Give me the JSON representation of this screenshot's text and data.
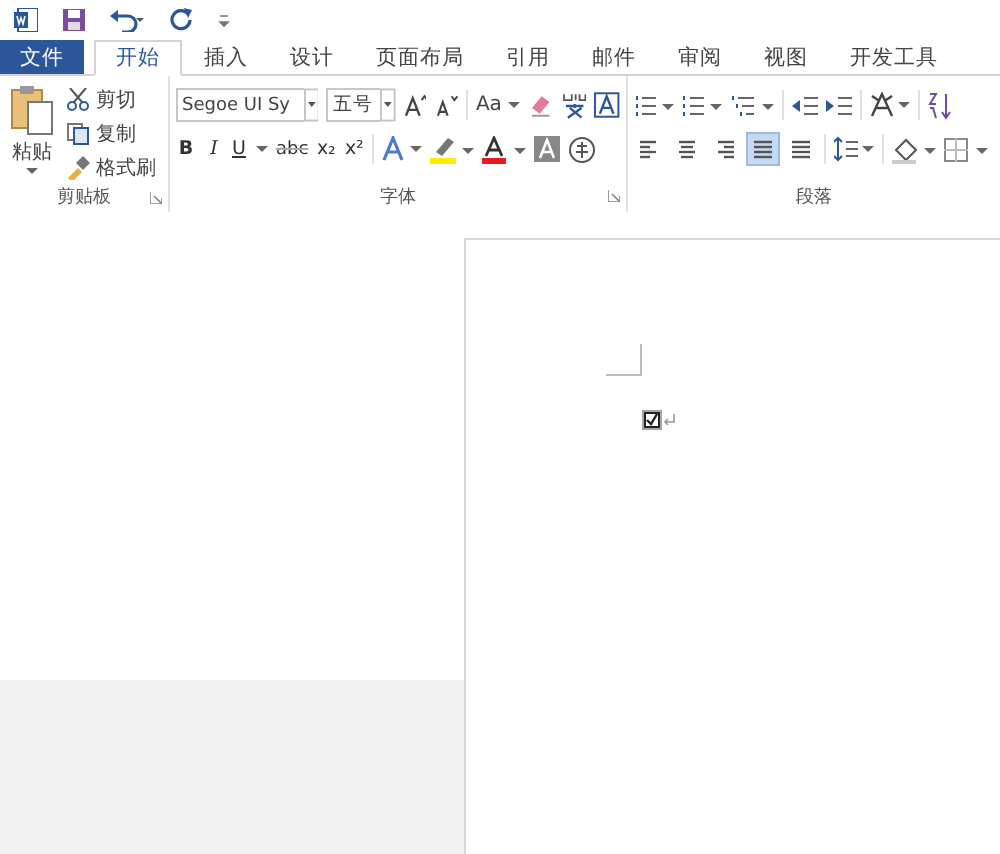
{
  "tabs": [
    {
      "label": "文件",
      "kind": "file",
      "selected": false
    },
    {
      "label": "开始",
      "kind": "tab",
      "selected": true
    },
    {
      "label": "插入",
      "kind": "tab",
      "selected": false
    },
    {
      "label": "设计",
      "kind": "tab",
      "selected": false
    },
    {
      "label": "页面布局",
      "kind": "tab",
      "selected": false
    },
    {
      "label": "引用",
      "kind": "tab",
      "selected": false
    },
    {
      "label": "邮件",
      "kind": "tab",
      "selected": false
    },
    {
      "label": "审阅",
      "kind": "tab",
      "selected": false
    },
    {
      "label": "视图",
      "kind": "tab",
      "selected": false
    },
    {
      "label": "开发工具",
      "kind": "tab",
      "selected": false
    }
  ],
  "clipboard": {
    "paste_label": "粘贴",
    "commands": [
      {
        "kind": "cut",
        "label": "剪切"
      },
      {
        "kind": "copy",
        "label": "复制"
      },
      {
        "kind": "painter",
        "label": "格式刷"
      }
    ],
    "group_label": "剪贴板"
  },
  "font": {
    "font_name": "Segoe UI Sy",
    "font_size": "五号",
    "case_label": "Aa",
    "format_buttons": [
      {
        "label": "B",
        "kind": "bold"
      },
      {
        "label": "I",
        "kind": "italic"
      },
      {
        "label": "U",
        "kind": "underline"
      },
      {
        "label": "abc",
        "kind": "strike"
      },
      {
        "label": "x₂",
        "kind": "plain"
      },
      {
        "label": "x²",
        "kind": "plain"
      }
    ],
    "group_label": "字体"
  },
  "paragraph": {
    "alignments": [
      {
        "kind": "left",
        "selected": false
      },
      {
        "kind": "center",
        "selected": false
      },
      {
        "kind": "right",
        "selected": false
      },
      {
        "kind": "justify",
        "selected": true
      },
      {
        "kind": "distributed",
        "selected": false
      }
    ],
    "group_label": "段落"
  },
  "document": {
    "checkbox": {
      "checked": true
    }
  }
}
